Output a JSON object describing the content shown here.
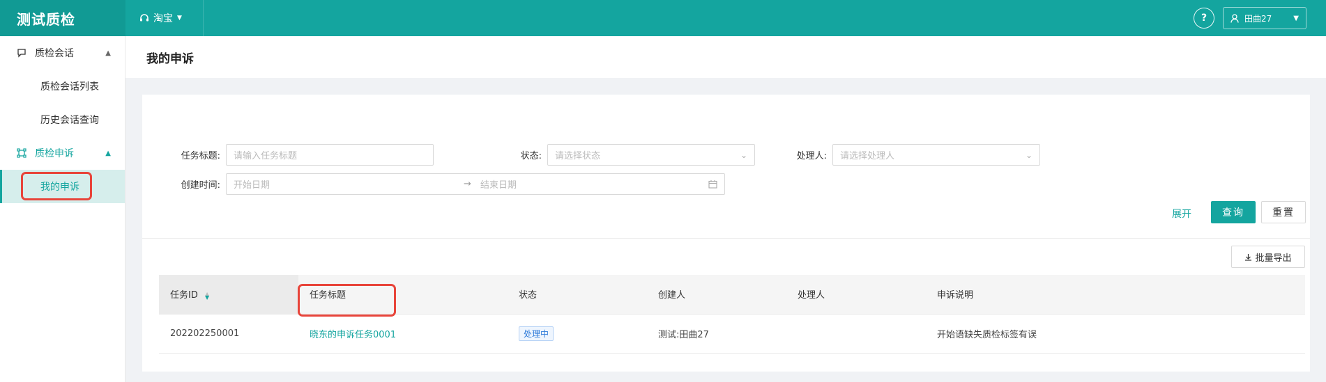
{
  "header": {
    "brand": "测试质检",
    "shop": "淘宝",
    "help_icon": "question-icon",
    "user": "田曲27"
  },
  "sidebar": {
    "groups": [
      {
        "label": "质检会话",
        "icon": "chat-icon",
        "items": [
          "质检会话列表",
          "历史会话查询"
        ]
      },
      {
        "label": "质检申诉",
        "icon": "appeal-icon",
        "items": [
          "我的申诉"
        ]
      }
    ],
    "selected": "我的申诉"
  },
  "page": {
    "title": "我的申诉"
  },
  "filters": {
    "task_title_label": "任务标题:",
    "task_title_placeholder": "请输入任务标题",
    "status_label": "状态:",
    "status_placeholder": "请选择状态",
    "handler_label": "处理人:",
    "handler_placeholder": "请选择处理人",
    "created_label": "创建时间:",
    "start_placeholder": "开始日期",
    "range_separator": "→",
    "end_placeholder": "结束日期"
  },
  "actions": {
    "expand": "展开",
    "query": "查询",
    "reset": "重置",
    "export": "批量导出"
  },
  "table": {
    "columns": [
      "任务ID",
      "任务标题",
      "状态",
      "创建人",
      "处理人",
      "申诉说明"
    ],
    "rows": [
      {
        "id": "202202250001",
        "title": "晓东的申诉任务0001",
        "status": "处理中",
        "creator": "测试:田曲27",
        "handler": "",
        "note": "开始语缺失质检标签有误"
      }
    ]
  },
  "colors": {
    "primary": "#14a59f",
    "highlight": "#e8443a",
    "tag": "#2f7bd9"
  }
}
